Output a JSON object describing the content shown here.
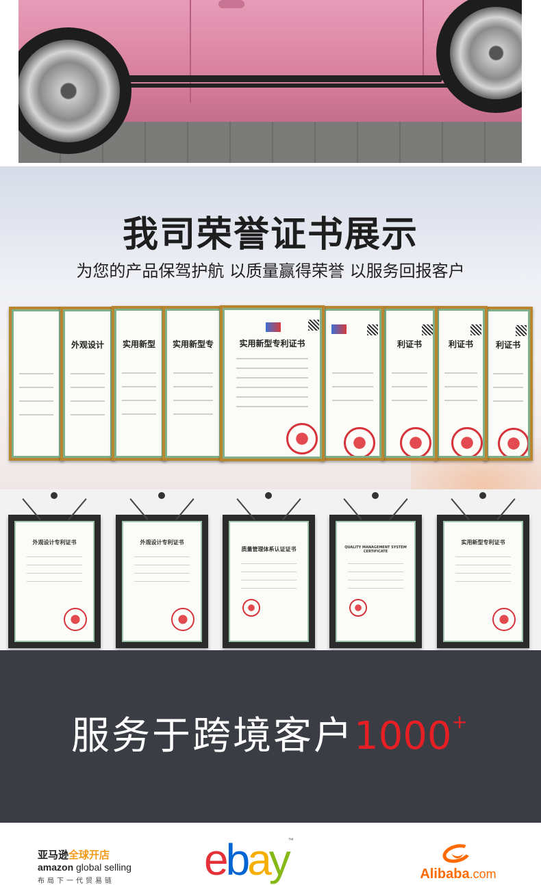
{
  "honor": {
    "title": "我司荣誉证书展示",
    "subtitle": "为您的产品保驾护航 以质量赢得荣誉 以服务回报客户",
    "certificates": [
      {
        "title": ""
      },
      {
        "title": "外观设计"
      },
      {
        "title": "实用新型"
      },
      {
        "title": "实用新型专"
      },
      {
        "title": "实用新型专利证书"
      },
      {
        "title": ""
      },
      {
        "title": "利证书"
      },
      {
        "title": "利证书"
      },
      {
        "title": "利证书"
      }
    ]
  },
  "frames": [
    {
      "title": "外观设计专利证书"
    },
    {
      "title": "外观设计专利证书"
    },
    {
      "title": "质量管理体系认证证书"
    },
    {
      "title": "QUALITY MANAGEMENT SYSTEM CERTIFICATE"
    },
    {
      "title": "实用新型专利证书"
    }
  ],
  "band": {
    "text": "服务于跨境客户",
    "number": "1000",
    "plus": "+"
  },
  "logos": {
    "amazon_cn": "亚马逊",
    "amazon_cn_accent": "全球开店",
    "amazon_en": "amazon",
    "amazon_gs": "global selling",
    "amazon_tagline": "布局下一代贸易链",
    "ebay": [
      "e",
      "b",
      "a",
      "y"
    ],
    "ebay_colors": [
      "#e53238",
      "#0064d2",
      "#f5af02",
      "#86b817"
    ],
    "ebay_tm": "™",
    "alibaba": "Alibaba",
    "alibaba_com": ".com"
  },
  "colors": {
    "accent_red": "#e51f24",
    "band_bg": "#3b3d45",
    "alibaba_orange": "#ff6a00"
  }
}
